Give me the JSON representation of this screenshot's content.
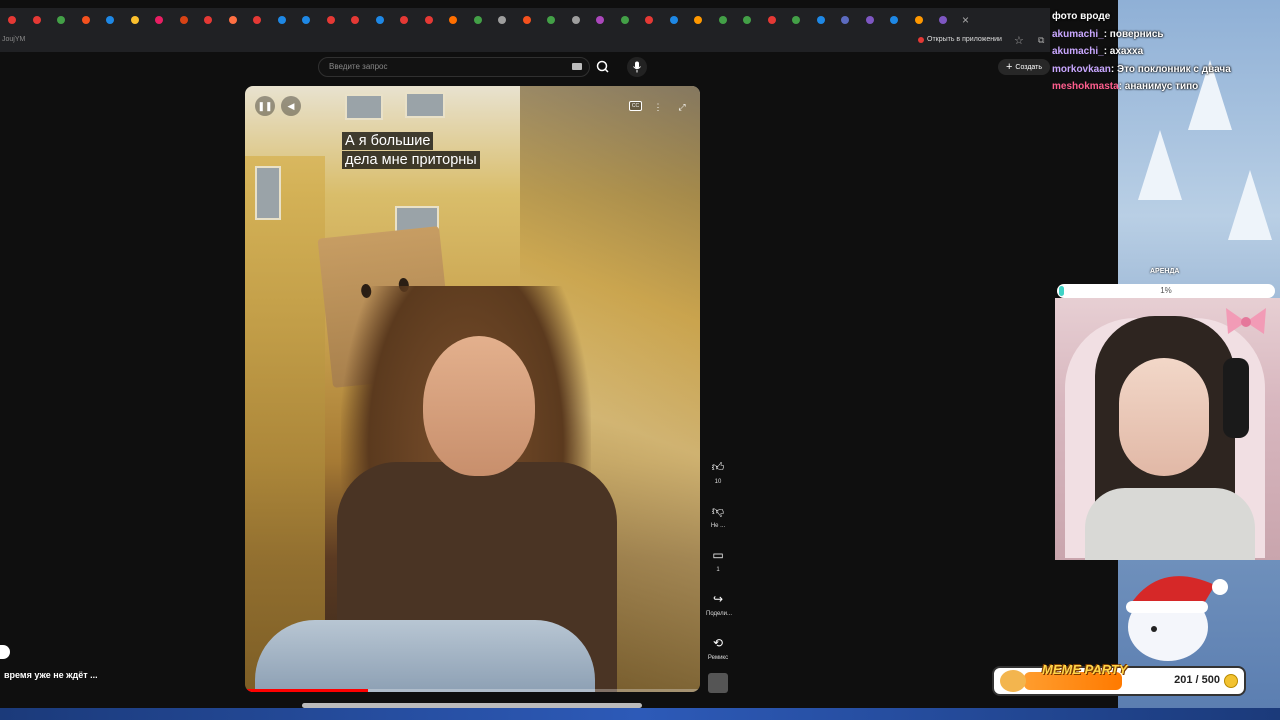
{
  "browser": {
    "url_fragment": "JoujYM",
    "open_in_app": "Открыть в приложении",
    "tab_colors": [
      "#e53935",
      "#e53935",
      "#43a047",
      "#f4511e",
      "#1e88e5",
      "#fbc02d",
      "#e91e63",
      "#d84315",
      "#e53935",
      "#ff7043",
      "#e53935",
      "#1e88e5",
      "#1e88e5",
      "#e53935",
      "#e53935",
      "#1e88e5",
      "#e53935",
      "#e53935",
      "#ff6f00",
      "#43a047",
      "#9e9e9e",
      "#f4511e",
      "#43a047",
      "#9e9e9e",
      "#ab47bc",
      "#43a047",
      "#e53935",
      "#1e88e5",
      "#ff9800",
      "#43a047",
      "#43a047",
      "#e53935",
      "#43a047",
      "#1e88e5",
      "#5c6bc0",
      "#7e57c2",
      "#1e88e5",
      "#ff9800",
      "#7e57c2"
    ]
  },
  "youtube": {
    "search_placeholder": "Введите запрос",
    "create_label": "Создать"
  },
  "video": {
    "subtitle_line1": "А я большие",
    "subtitle_line2": "дела мне приторны",
    "progress": 0.27
  },
  "actions": {
    "like_count": "10",
    "dislike_label": "Не ...",
    "comments_count": "1",
    "share_label": "Подели...",
    "remix_label": "Ремикс"
  },
  "left": {
    "text": "время уже не ждёт ..."
  },
  "stream": {
    "chat": [
      {
        "user": "",
        "color": "#ffffff",
        "msg": "фото вроде"
      },
      {
        "user": "akumachi_",
        "color": "#c9a7ff",
        "msg": ": повернись"
      },
      {
        "user": "akumachi_",
        "color": "#c9a7ff",
        "msg": ": ахахха"
      },
      {
        "user": "morkovkaan",
        "color": "#c9a7ff",
        "msg": ": Это поклонник с двача"
      },
      {
        "user": "meshokmasta",
        "color": "#ff5e8e",
        "msg": ": ананимус типо"
      }
    ],
    "rent_label": "АРЕНДА",
    "goal_percent": "1%",
    "meme_title": "MEME PARTY",
    "meme_count": "201 / 500"
  }
}
